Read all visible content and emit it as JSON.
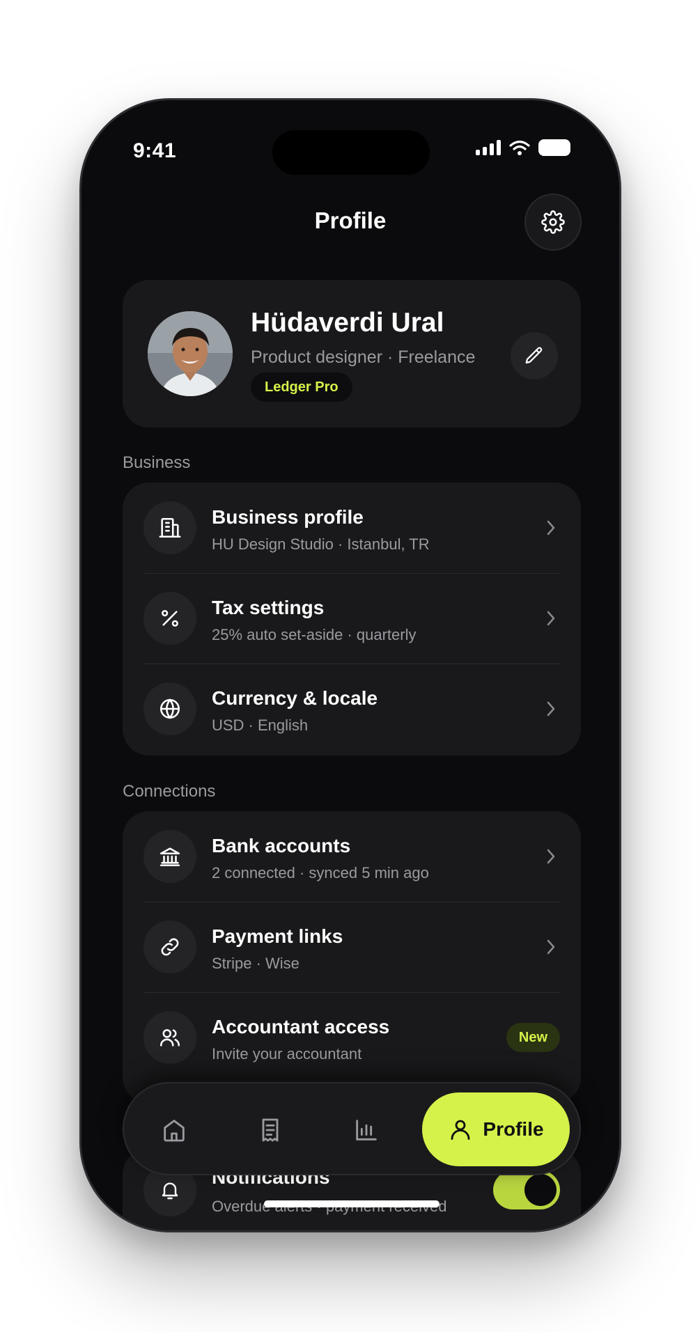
{
  "status_bar": {
    "time": "9:41"
  },
  "header": {
    "title": "Profile"
  },
  "profile": {
    "name": "Hüdaverdi Ural",
    "role": "Product designer · Freelance",
    "plan_badge": "Ledger Pro"
  },
  "sections": {
    "business": {
      "label": "Business",
      "items": [
        {
          "title": "Business profile",
          "subtitle": "HU Design Studio · Istanbul, TR",
          "icon": "building-icon"
        },
        {
          "title": "Tax settings",
          "subtitle": "25% auto set-aside · quarterly",
          "icon": "percent-icon"
        },
        {
          "title": "Currency & locale",
          "subtitle": "USD · English",
          "icon": "globe-icon"
        }
      ]
    },
    "connections": {
      "label": "Connections",
      "items": [
        {
          "title": "Bank accounts",
          "subtitle": "2 connected · synced 5 min ago",
          "icon": "bank-icon"
        },
        {
          "title": "Payment links",
          "subtitle": "Stripe · Wise",
          "icon": "link-icon"
        },
        {
          "title": "Accountant access",
          "subtitle": "Invite your accountant",
          "icon": "users-icon",
          "badge": "New"
        }
      ]
    },
    "notifications": {
      "title": "Notifications",
      "subtitle": "Overdue alerts · payment received",
      "toggle_on": true
    }
  },
  "tabbar": {
    "tabs": [
      "home-icon",
      "receipt-icon",
      "chart-icon",
      "profile-icon"
    ],
    "active_label": "Profile"
  },
  "colors": {
    "accent": "#d5f24a",
    "background": "#0b0b0d",
    "card": "#19191b"
  }
}
